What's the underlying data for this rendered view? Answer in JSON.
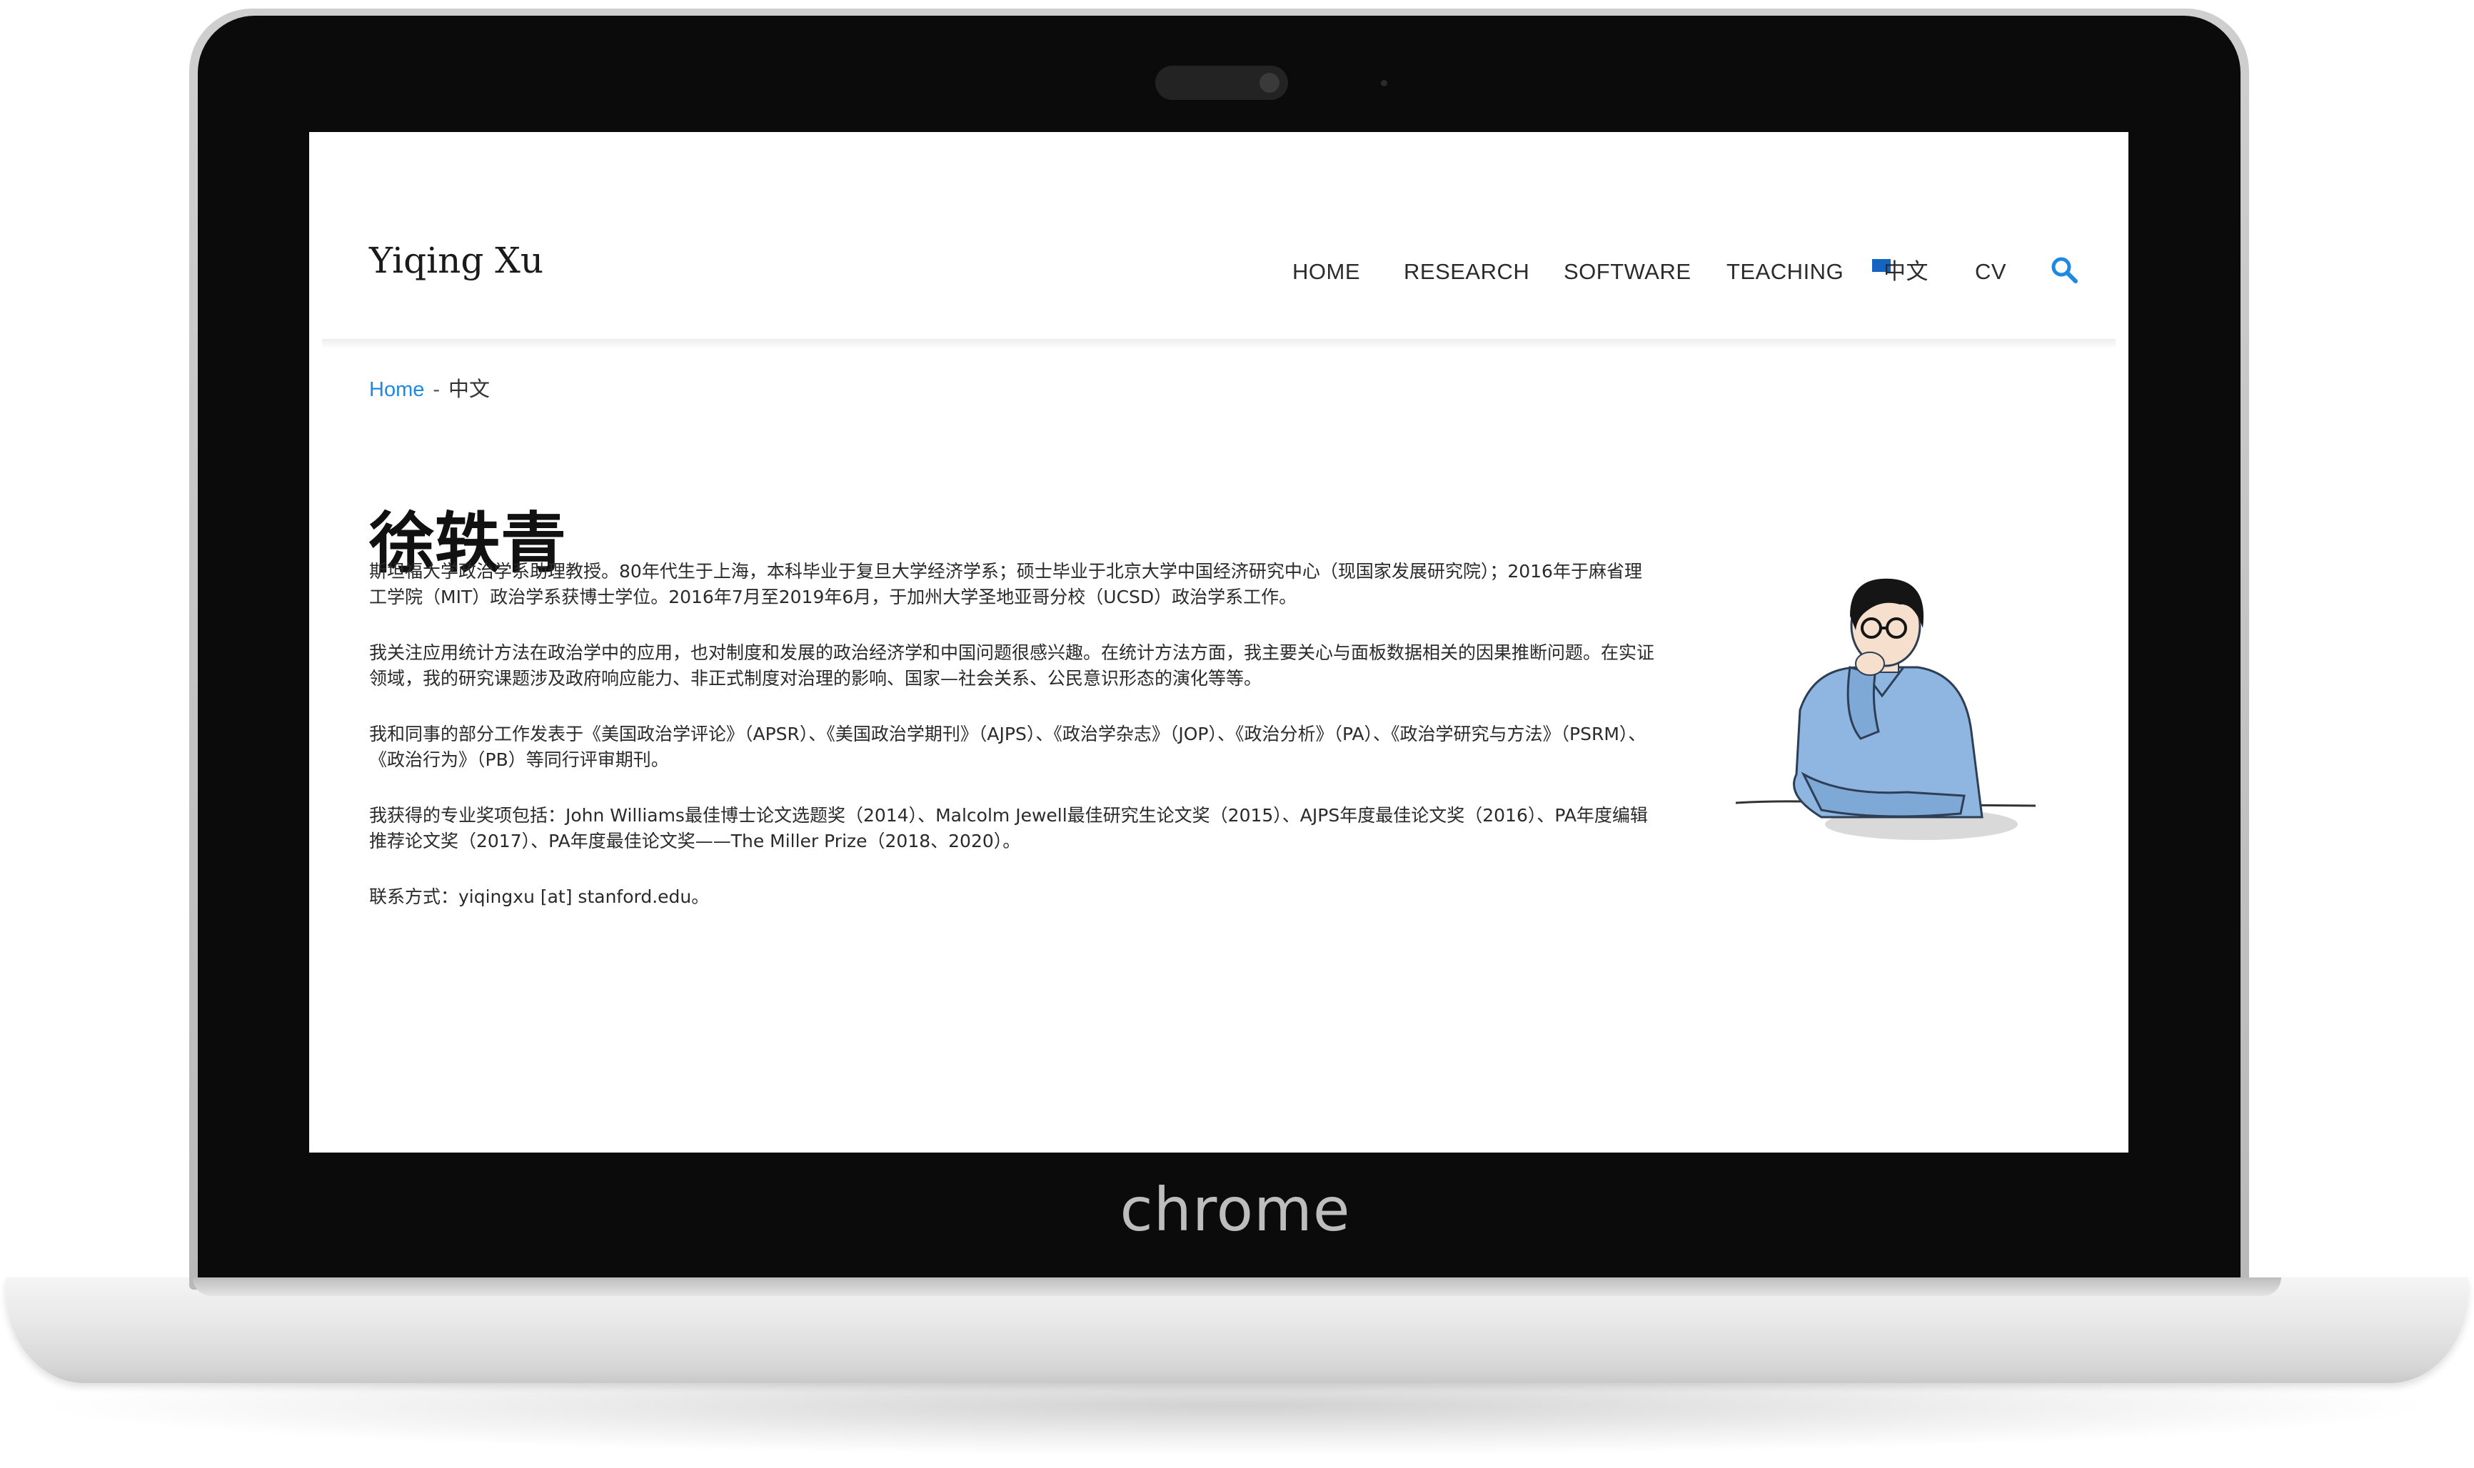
{
  "device": {
    "brand_label": "chrome"
  },
  "site": {
    "title": "Yiqing Xu",
    "nav": [
      {
        "label": "HOME"
      },
      {
        "label": "RESEARCH"
      },
      {
        "label": "SOFTWARE"
      },
      {
        "label": "TEACHING"
      },
      {
        "label": "中文"
      },
      {
        "label": "CV"
      }
    ]
  },
  "breadcrumb": {
    "home": "Home",
    "separator": "-",
    "current": "中文"
  },
  "page": {
    "title": "徐轶青",
    "paragraphs": [
      "斯坦福大学政治学系助理教授。80年代生于上海，本科毕业于复旦大学经济学系；硕士毕业于北京大学中国经济研究中心（现国家发展研究院）；2016年于麻省理工学院（MIT）政治学系获博士学位。2016年7月至2019年6月，于加州大学圣地亚哥分校（UCSD）政治学系工作。",
      "我关注应用统计方法在政治学中的应用，也对制度和发展的政治经济学和中国问题很感兴趣。在统计方法方面，我主要关心与面板数据相关的因果推断问题。在实证领域，我的研究课题涉及政府响应能力、非正式制度对治理的影响、国家—社会关系、公民意识形态的演化等等。",
      "我和同事的部分工作发表于《美国政治学评论》（APSR）、《美国政治学期刊》（AJPS）、《政治学杂志》（JOP）、《政治分析》（PA）、《政治学研究与方法》（PSRM）、《政治行为》（PB）等同行评审期刊。",
      "我获得的专业奖项包括：John Williams最佳博士论文选题奖（2014）、Malcolm Jewell最佳研究生论文奖（2015）、AJPS年度最佳论文奖（2016）、PA年度编辑推荐论文奖（2017）、PA年度最佳论文奖——The Miller Prize（2018、2020）。",
      "联系方式：yiqingxu [at] stanford.edu。"
    ]
  },
  "icons": {
    "search": "search-icon",
    "flag": "flag-icon",
    "portrait": "portrait-illustration"
  },
  "colors": {
    "link": "#1e88e5",
    "search_icon": "#1e88e5",
    "flag": "#1565c0"
  }
}
